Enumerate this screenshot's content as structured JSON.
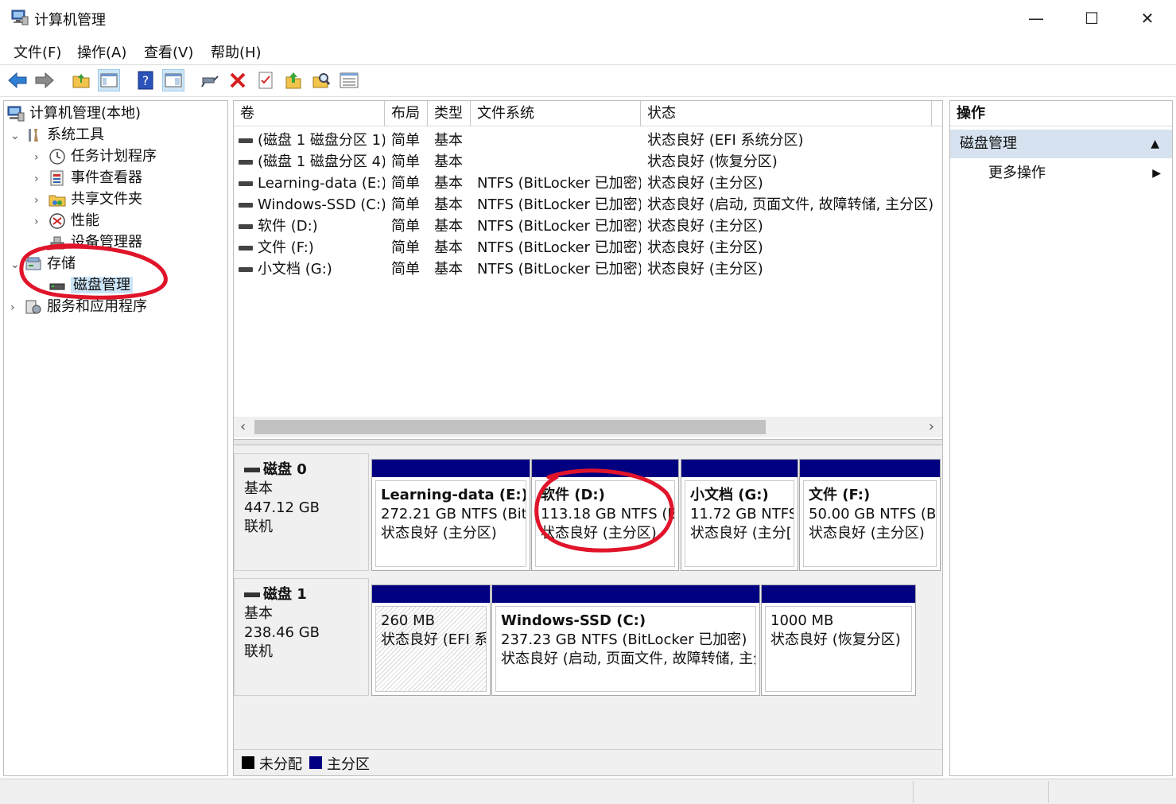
{
  "window": {
    "title": "计算机管理",
    "min": "—",
    "max": "☐",
    "close": "✕"
  },
  "menu": [
    "文件(F)",
    "操作(A)",
    "查看(V)",
    "帮助(H)"
  ],
  "tree": {
    "root": "计算机管理(本地)",
    "system_tools": "系统工具",
    "task_scheduler": "任务计划程序",
    "event_viewer": "事件查看器",
    "shared_folders": "共享文件夹",
    "performance": "性能",
    "device_manager": "设备管理器",
    "storage": "存储",
    "disk_management": "磁盘管理",
    "services_apps": "服务和应用程序"
  },
  "volumes": {
    "headers": [
      "卷",
      "布局",
      "类型",
      "文件系统",
      "状态"
    ],
    "rows": [
      [
        "(磁盘 1 磁盘分区 1)",
        "简单",
        "基本",
        "",
        "状态良好 (EFI 系统分区)"
      ],
      [
        "(磁盘 1 磁盘分区 4)",
        "简单",
        "基本",
        "",
        "状态良好 (恢复分区)"
      ],
      [
        "Learning-data (E:)",
        "简单",
        "基本",
        "NTFS (BitLocker 已加密)",
        "状态良好 (主分区)"
      ],
      [
        "Windows-SSD (C:)",
        "简单",
        "基本",
        "NTFS (BitLocker 已加密)",
        "状态良好 (启动, 页面文件, 故障转储, 主分区)"
      ],
      [
        "软件 (D:)",
        "简单",
        "基本",
        "NTFS (BitLocker 已加密)",
        "状态良好 (主分区)"
      ],
      [
        "文件 (F:)",
        "简单",
        "基本",
        "NTFS (BitLocker 已加密)",
        "状态良好 (主分区)"
      ],
      [
        "小文档 (G:)",
        "简单",
        "基本",
        "NTFS (BitLocker 已加密)",
        "状态良好 (主分区)"
      ]
    ]
  },
  "disks": [
    {
      "name": "磁盘 0",
      "type": "基本",
      "size": "447.12 GB",
      "state": "联机",
      "partitions": [
        {
          "name": "Learning-data  (E:)",
          "info": "272.21 GB NTFS (BitL",
          "status": "状态良好 (主分区)"
        },
        {
          "name": "软件  (D:)",
          "info": "113.18 GB NTFS (Bi",
          "status": "状态良好 (主分区)"
        },
        {
          "name": "小文档  (G:)",
          "info": "11.72 GB NTFS",
          "status": "状态良好 (主分["
        },
        {
          "name": "文件  (F:)",
          "info": "50.00 GB NTFS (Bi",
          "status": "状态良好 (主分区)"
        }
      ]
    },
    {
      "name": "磁盘 1",
      "type": "基本",
      "size": "238.46 GB",
      "state": "联机",
      "partitions": [
        {
          "name": "",
          "info": "260 MB",
          "status": "状态良好 (EFI 系"
        },
        {
          "name": "Windows-SSD  (C:)",
          "info": "237.23 GB NTFS (BitLocker 已加密)",
          "status": "状态良好 (启动, 页面文件, 故障转储, 主分"
        },
        {
          "name": "",
          "info": "1000 MB",
          "status": "状态良好 (恢复分区)"
        }
      ]
    }
  ],
  "legend": {
    "unallocated": "未分配",
    "primary": "主分区"
  },
  "actions": {
    "header": "操作",
    "section": "磁盘管理",
    "more": "更多操作"
  },
  "colors": {
    "primary_band": "#000080",
    "selection": "#cce4f7",
    "annotation": "#e0142a"
  }
}
